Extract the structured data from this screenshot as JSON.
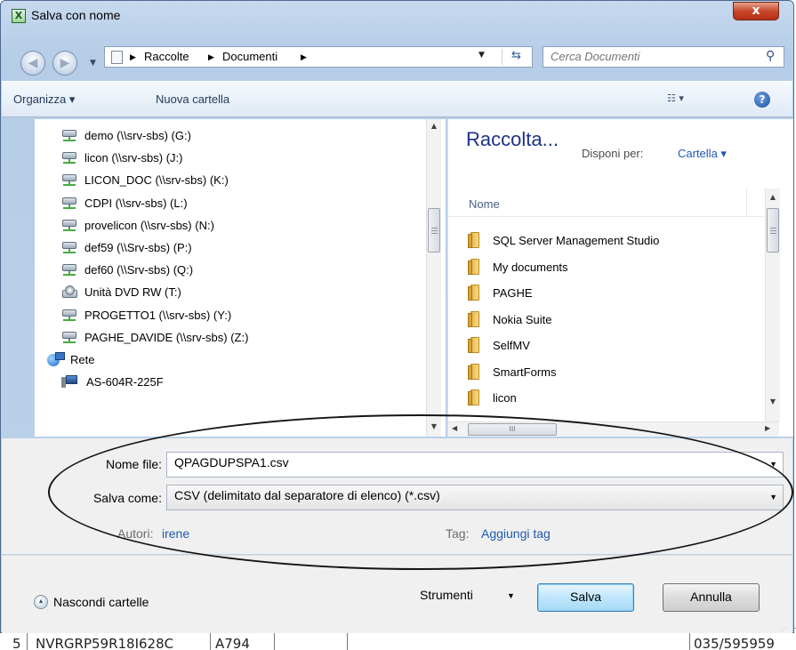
{
  "background_sheet": {
    "cells": [
      "5",
      "NVRGRP59R18I628C",
      "A794",
      "035/595959"
    ]
  },
  "window": {
    "title": "Salva con nome",
    "app_icon_text": "X",
    "close_label": "x"
  },
  "nav": {
    "breadcrumbs": [
      "Raccolte",
      "Documenti"
    ],
    "search_placeholder": "Cerca Documenti"
  },
  "toolbar": {
    "organize_label": "Organizza ▾",
    "new_folder_label": "Nuova cartella",
    "help_label": "?"
  },
  "tree": {
    "items": [
      {
        "label": "demo (\\\\srv-sbs) (G:)",
        "icon": "network-drive-icon"
      },
      {
        "label": "licon (\\\\srv-sbs) (J:)",
        "icon": "network-drive-icon"
      },
      {
        "label": "LICON_DOC (\\\\srv-sbs) (K:)",
        "icon": "network-drive-icon"
      },
      {
        "label": "CDPI (\\\\srv-sbs) (L:)",
        "icon": "network-drive-icon"
      },
      {
        "label": "provelicon (\\\\srv-sbs) (N:)",
        "icon": "network-drive-icon"
      },
      {
        "label": "def59 (\\\\Srv-sbs) (P:)",
        "icon": "network-drive-icon"
      },
      {
        "label": "def60 (\\\\Srv-sbs) (Q:)",
        "icon": "network-drive-icon"
      },
      {
        "label": "Unità DVD RW (T:)",
        "icon": "dvd-drive-icon"
      },
      {
        "label": "PROGETTO1 (\\\\srv-sbs) (Y:)",
        "icon": "network-drive-icon"
      },
      {
        "label": "PAGHE_DAVIDE (\\\\srv-sbs) (Z:)",
        "icon": "network-drive-icon"
      },
      {
        "label": "Rete",
        "icon": "network-icon"
      },
      {
        "label": "AS-604R-225F",
        "icon": "computer-icon"
      }
    ]
  },
  "library": {
    "title": "Raccolta...",
    "arrange_label": "Disponi per:",
    "arrange_value": "Cartella ▾",
    "column_header": "Nome",
    "folders": [
      "SQL Server Management Studio",
      "My documents",
      "PAGHE",
      "Nokia Suite",
      "SelfMV",
      "SmartForms",
      "licon"
    ]
  },
  "form": {
    "filename_label": "Nome file:",
    "filename_value": "QPAGDUPSPA1.csv",
    "savetype_label": "Salva come:",
    "savetype_value": "CSV (delimitato dal separatore di elenco) (*.csv)",
    "authors_label": "Autori:",
    "authors_value": "irene",
    "tags_label": "Tag:",
    "tags_value": "Aggiungi tag"
  },
  "footer": {
    "hide_folders_label": "Nascondi cartelle",
    "tools_label": "Strumenti",
    "save_label": "Salva",
    "cancel_label": "Annulla"
  },
  "colors": {
    "link": "#1e59b0",
    "library_title": "#1e3287",
    "annotation_ellipse": "#151515"
  }
}
